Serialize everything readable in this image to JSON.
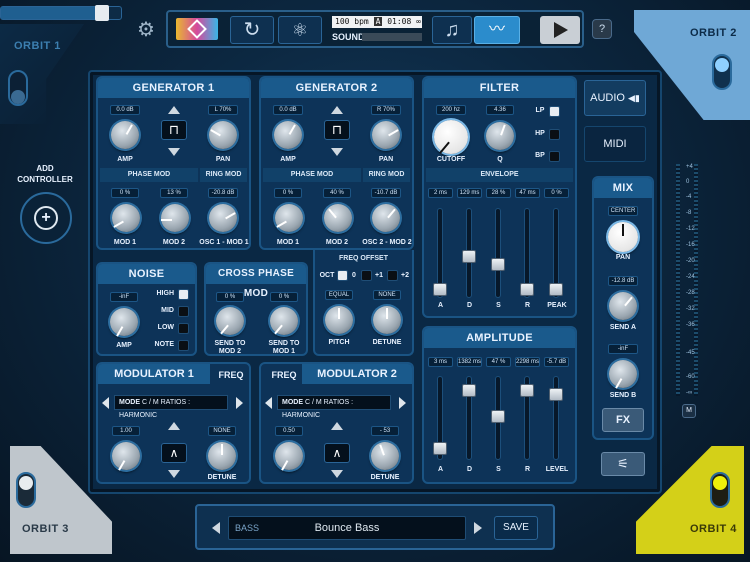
{
  "top": {
    "transport_tempo": "100",
    "tempo_unit": "bpm",
    "mode_letter": "A",
    "time": "01:08",
    "sound_label": "SOUND",
    "help": "?"
  },
  "corners": {
    "orbit1": "ORBIT 1",
    "orbit2": "ORBIT 2",
    "orbit3": "ORBIT 3",
    "orbit4": "ORBIT 4"
  },
  "left": {
    "add_controller": "ADD\nCONTROLLER",
    "add_line1": "ADD",
    "add_line2": "CONTROLLER"
  },
  "gen1": {
    "title": "GENERATOR 1",
    "amp_val": "0.0 dB",
    "amp": "AMP",
    "pan_val": "L 70%",
    "pan": "PAN",
    "phase": "PHASE MOD",
    "ring": "RING MOD",
    "mod1_val": "0 %",
    "mod2_val": "13 %",
    "osc_val": "-20.8 dB",
    "mod1": "MOD 1",
    "mod2": "MOD 2",
    "osc": "OSC 1 - MOD 1"
  },
  "gen2": {
    "title": "GENERATOR 2",
    "amp_val": "0.0 dB",
    "amp": "AMP",
    "pan_val": "R 70%",
    "pan": "PAN",
    "phase": "PHASE MOD",
    "ring": "RING MOD",
    "mod1_val": "0 %",
    "mod2_val": "40 %",
    "osc_val": "-10.7 dB",
    "mod1": "MOD 1",
    "mod2": "MOD 2",
    "osc": "OSC 2 - MOD 2"
  },
  "filter": {
    "title": "FILTER",
    "cutoff_val": "200 hz",
    "cutoff": "CUTOFF",
    "q_val": "4.36",
    "q": "Q",
    "lp": "LP",
    "hp": "HP",
    "bp": "BP",
    "envelope": "ENVELOPE",
    "env_vals": [
      "2 ms",
      "129 ms",
      "28 %",
      "47 ms",
      "0 %"
    ],
    "env_labels": [
      "A",
      "D",
      "S",
      "R",
      "PEAK"
    ]
  },
  "noise": {
    "title": "NOISE",
    "amp_val": "-inF",
    "amp": "AMP",
    "high": "HIGH",
    "mid": "MID",
    "low": "LOW",
    "note": "NOTE"
  },
  "cross": {
    "title": "CROSS PHASE MOD",
    "v1": "0 %",
    "v2": "0 %",
    "l1a": "SEND TO",
    "l1b": "MOD 2",
    "l2a": "SEND TO",
    "l2b": "MOD 1"
  },
  "freq": {
    "title": "FREQ OFFSET",
    "oct": "OCT",
    "o0": "0",
    "o1": "+1",
    "o2": "+2",
    "pitch_val": "EQUAL",
    "pitch": "PITCH",
    "detune_val": "NONE",
    "detune": "DETUNE"
  },
  "amp": {
    "title": "AMPLITUDE",
    "vals": [
      "3 ms",
      "1382 ms",
      "47 %",
      "2298 ms",
      "-5.7 dB"
    ],
    "labels": [
      "A",
      "D",
      "S",
      "R",
      "LEVEL"
    ]
  },
  "mod1": {
    "title": "MODULATOR 1",
    "freq": "FREQ",
    "mode": "MODE",
    "mode_text": "C / M RATIOS : HARMONIC",
    "k1_val": "1.00",
    "k2_val": "NONE",
    "detune": "DETUNE"
  },
  "mod2": {
    "title": "MODULATOR 2",
    "freq": "FREQ",
    "mode": "MODE",
    "mode_text": "C / M RATIOS : HARMONIC",
    "k1_val": "0.50",
    "k2_val": "- 53",
    "detune": "DETUNE"
  },
  "tabs": {
    "audio": "AUDIO",
    "midi": "MIDI"
  },
  "mix": {
    "title": "MIX",
    "pan_val": "CENTER",
    "pan": "PAN",
    "senda_val": "-12.8 dB",
    "senda": "SEND A",
    "sendb_val": "-inF",
    "sendb": "SEND B",
    "fx": "FX"
  },
  "meter": {
    "labels": [
      "+4",
      "0",
      "-4",
      "-8",
      "-12",
      "-16",
      "-20",
      "-24",
      "-28",
      "-32",
      "-36",
      "-45",
      "-60",
      "-∞"
    ],
    "m": "M"
  },
  "preset": {
    "category": "BASS",
    "name": "Bounce Bass",
    "save": "SAVE"
  },
  "colors": {
    "accent": "#3aa0d8",
    "orbit2": "#5aa0d0",
    "orbit4": "#d7d21a",
    "panel": "#0d3358"
  }
}
